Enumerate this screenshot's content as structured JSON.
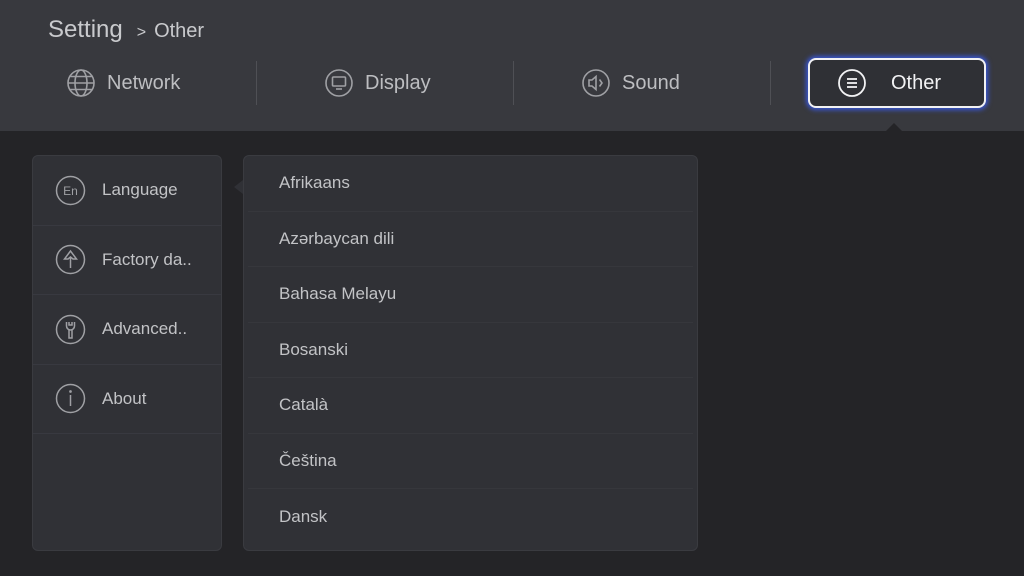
{
  "breadcrumb": {
    "root": "Setting",
    "separator": ">",
    "current": "Other"
  },
  "tabs": [
    {
      "label": "Network",
      "icon": "globe-icon"
    },
    {
      "label": "Display",
      "icon": "monitor-icon"
    },
    {
      "label": "Sound",
      "icon": "speaker-icon"
    },
    {
      "label": "Other",
      "icon": "menu-lines-icon",
      "selected": true
    }
  ],
  "sidebar": {
    "items": [
      {
        "label": "Language",
        "icon": "language-en-icon",
        "icon_text": "En",
        "selected": true
      },
      {
        "label": "Factory da..",
        "icon": "factory-reset-icon"
      },
      {
        "label": "Advanced..",
        "icon": "wrench-icon"
      },
      {
        "label": "About",
        "icon": "info-icon"
      }
    ]
  },
  "languages": [
    "Afrikaans",
    "Azərbaycan dili",
    "Bahasa Melayu",
    "Bosanski",
    "Català",
    "Čeština",
    "Dansk"
  ],
  "colors": {
    "header_bg": "#38393e",
    "page_bg": "#242427",
    "panel_bg": "#303136",
    "focus_glow": "#3a57d6"
  }
}
